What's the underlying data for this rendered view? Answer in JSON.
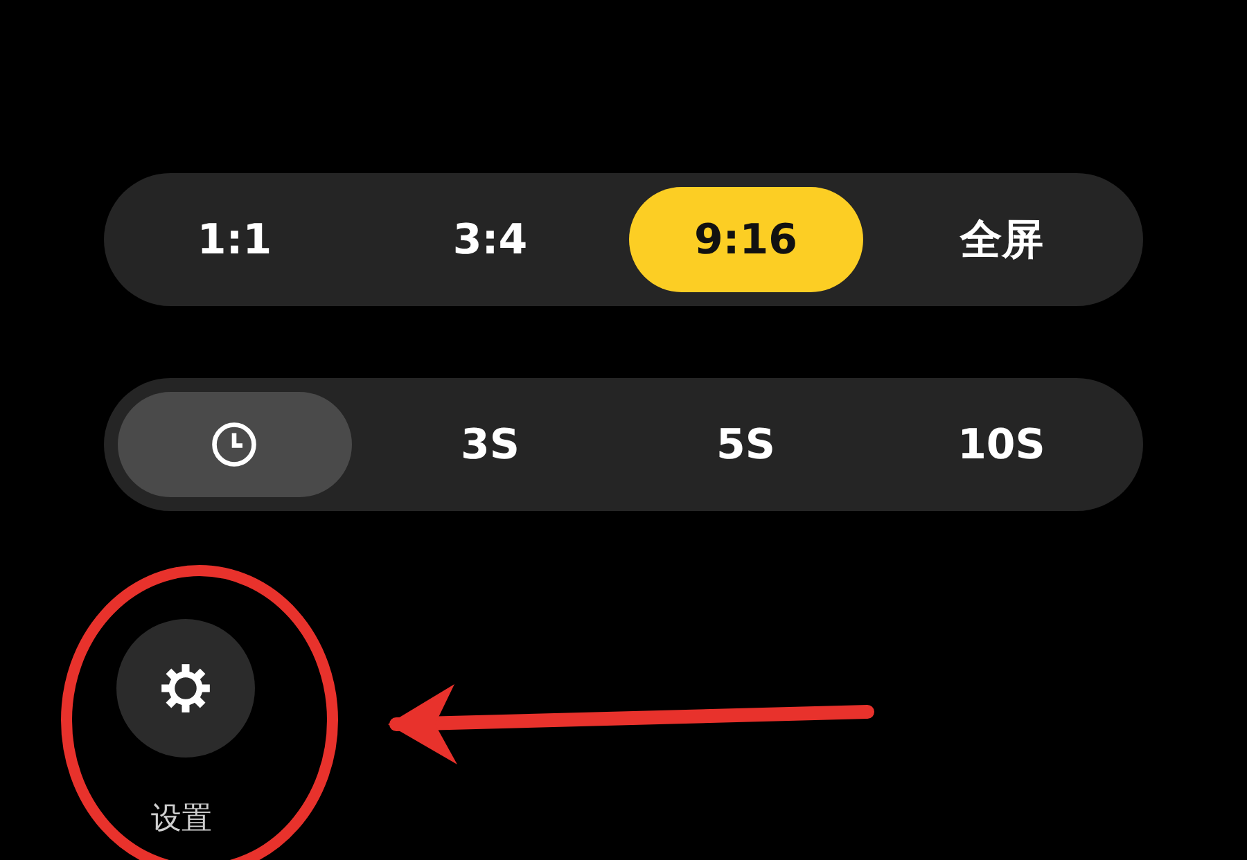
{
  "aspect_ratios": [
    {
      "label": "1:1",
      "selected": false
    },
    {
      "label": "3:4",
      "selected": false
    },
    {
      "label": "9:16",
      "selected": true
    },
    {
      "label": "全屏",
      "selected": false
    }
  ],
  "timer_options": [
    {
      "kind": "icon",
      "selected": true
    },
    {
      "kind": "text",
      "label": "3S",
      "selected": false
    },
    {
      "kind": "text",
      "label": "5S",
      "selected": false
    },
    {
      "kind": "text",
      "label": "10S",
      "selected": false
    }
  ],
  "settings_button": {
    "label": "设置"
  }
}
